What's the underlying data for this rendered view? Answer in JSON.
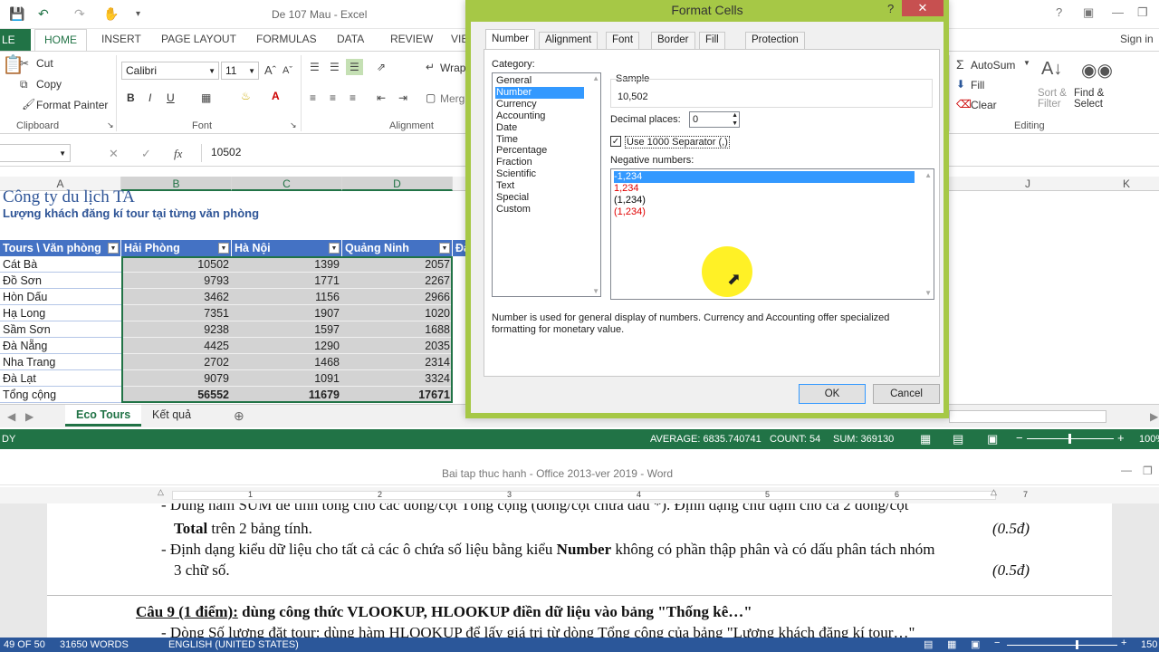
{
  "excel": {
    "window_title": "De 107 Mau - Excel",
    "sign_in": "Sign in",
    "tabs": [
      "LE",
      "HOME",
      "INSERT",
      "PAGE LAYOUT",
      "FORMULAS",
      "DATA",
      "REVIEW",
      "VIE"
    ],
    "clipboard": {
      "cut": "Cut",
      "copy": "Copy",
      "format_painter": "Format Painter",
      "label": "Clipboard"
    },
    "font": {
      "name": "Calibri",
      "size": "11",
      "label": "Font",
      "bold": "B",
      "italic": "I",
      "underline": "U"
    },
    "alignment": {
      "wrap": "Wrap",
      "merge": "Merg",
      "label": "Alignment"
    },
    "editing": {
      "autosum": "AutoSum",
      "fill": "Fill",
      "clear": "Clear",
      "sort_filter": "Sort & Filter",
      "find_select": "Find & Select",
      "label": "Editing"
    },
    "formula_value": "10502",
    "columns": [
      "A",
      "B",
      "C",
      "D",
      "J",
      "K"
    ],
    "title_cell": "Công ty du lịch TA",
    "subtitle_cell": "Lượng khách đăng kí tour tại từng văn phòng",
    "table": {
      "headers": [
        "Tours \\ Văn phòng",
        "Hải Phòng",
        "Hà Nội",
        "Quảng Ninh",
        "Đà"
      ],
      "rows": [
        {
          "name": "Cát Bà",
          "b": "10502",
          "c": "1399",
          "d": "2057"
        },
        {
          "name": "Đồ Sơn",
          "b": "9793",
          "c": "1771",
          "d": "2267"
        },
        {
          "name": "Hòn Dấu",
          "b": "3462",
          "c": "1156",
          "d": "2966"
        },
        {
          "name": "Hạ Long",
          "b": "7351",
          "c": "1907",
          "d": "1020"
        },
        {
          "name": "Sầm Sơn",
          "b": "9238",
          "c": "1597",
          "d": "1688"
        },
        {
          "name": "Đà Nẵng",
          "b": "4425",
          "c": "1290",
          "d": "2035"
        },
        {
          "name": "Nha Trang",
          "b": "2702",
          "c": "1468",
          "d": "2314"
        },
        {
          "name": "Đà Lạt",
          "b": "9079",
          "c": "1091",
          "d": "3324"
        }
      ],
      "total": {
        "name": "Tổng cộng",
        "b": "56552",
        "c": "11679",
        "d": "17671"
      }
    },
    "sheets": [
      "Eco Tours",
      "Kết quả"
    ],
    "status": {
      "ready": "DY",
      "average": "AVERAGE: 6835.740741",
      "count": "COUNT: 54",
      "sum": "SUM: 369130",
      "zoom": "100%"
    }
  },
  "dialog": {
    "title": "Format Cells",
    "help": "?",
    "close": "✕",
    "tabs": [
      "Number",
      "Alignment",
      "Font",
      "Border",
      "Fill",
      "Protection"
    ],
    "category_label": "Category:",
    "categories": [
      "General",
      "Number",
      "Currency",
      "Accounting",
      "Date",
      "Time",
      "Percentage",
      "Fraction",
      "Scientific",
      "Text",
      "Special",
      "Custom"
    ],
    "selected_category": "Number",
    "sample_label": "Sample",
    "sample_value": "10,502",
    "decimal_label": "Decimal places:",
    "decimal_value": "0",
    "separator_label": "Use 1000 Separator (,)",
    "negative_label": "Negative numbers:",
    "negatives": [
      {
        "text": "-1,234",
        "color": "#000000"
      },
      {
        "text": "1,234",
        "color": "#e00000"
      },
      {
        "text": "(1,234)",
        "color": "#000000"
      },
      {
        "text": "(1,234)",
        "color": "#e00000"
      }
    ],
    "description": "Number is used for general display of numbers.  Currency and Accounting offer specialized formatting for monetary value.",
    "ok": "OK",
    "cancel": "Cancel"
  },
  "word": {
    "window_title": "Bai tap thuc hanh - Office 2013-ver 2019 - Word",
    "ruler": [
      "1",
      "2",
      "3",
      "4",
      "5",
      "6",
      "7"
    ],
    "line1": "- Dùng hàm SUM để tính tổng cho các dòng/cột Tổng cộng (dòng/cột chứa dấu *). Định dạng chữ đậm cho cả 2 dòng/cột",
    "line2_bold": "Total",
    "line2_rest": " trên 2 bảng tính.",
    "score": "(0.5đ)",
    "line3_a": "- Định dạng kiểu dữ liệu cho tất cả các ô chứa số liệu bằng kiểu ",
    "line3_bold": "Number",
    "line3_b": " không có phần thập phân và có dấu phân tách nhóm",
    "line4": "3 chữ số.",
    "q9_head": "Câu 9 (1 điểm):",
    "q9_rest": " dùng công thức VLOOKUP, HLOOKUP điền dữ liệu vào bảng \"Thống kê…\"",
    "line6": "- Dòng Số lượng đặt tour: dùng hàm HLOOKUP để lấy giá trị từ dòng Tổng cộng của bảng \"Lượng khách đăng kí tour…\"",
    "status": {
      "page": "49 OF 50",
      "words": "31650 WORDS",
      "lang": "ENGLISH (UNITED STATES)",
      "zoom": "150"
    }
  }
}
